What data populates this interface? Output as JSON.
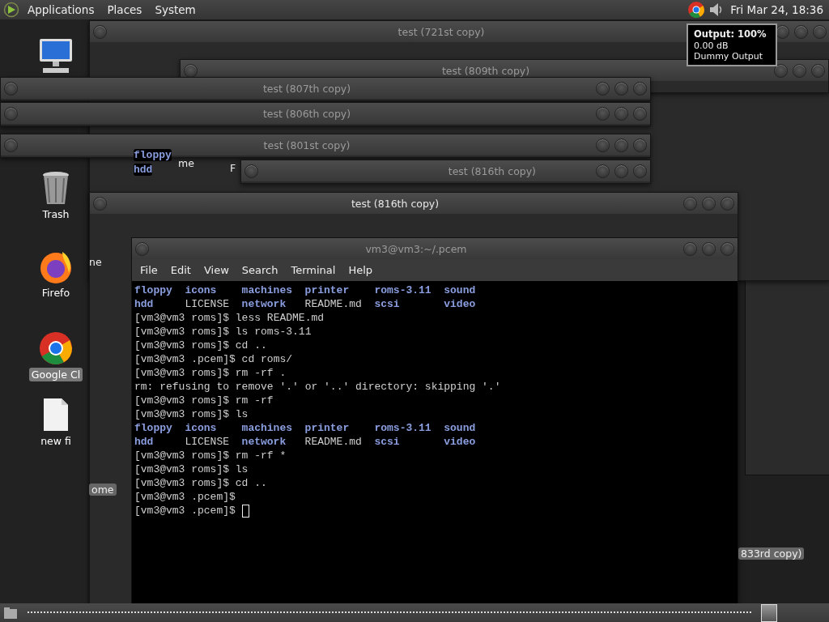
{
  "top_panel": {
    "menus": [
      "Applications",
      "Places",
      "System"
    ],
    "clock": "Fri Mar 24, 18:36"
  },
  "tooltip": {
    "title": "Output: 100%",
    "lines": [
      "0.00 dB",
      "Dummy Output"
    ]
  },
  "desktop_icons": [
    {
      "kind": "computer"
    },
    {
      "kind": "trash",
      "label": "Trash",
      "selected": false
    },
    {
      "kind": "firefox",
      "label": "Firefo",
      "selected": false
    },
    {
      "kind": "chrome",
      "label": "Google Cl",
      "selected": true
    },
    {
      "kind": "file",
      "label": "new fi",
      "selected": false
    }
  ],
  "windows": [
    {
      "title": "test (721st copy)"
    },
    {
      "title": "test (809th copy)"
    },
    {
      "title": "test (807th copy)"
    },
    {
      "title": "test (806th copy)"
    },
    {
      "title": "test (801st copy)"
    },
    {
      "title": "test (816th copy)"
    },
    {
      "title": "test (816th copy)"
    }
  ],
  "fragments": [
    {
      "kind": "dir",
      "text": "floppy"
    },
    {
      "kind": "dir",
      "text": "hdd"
    },
    {
      "kind": "label",
      "text": "me"
    },
    {
      "kind": "label",
      "text": "F"
    },
    {
      "kind": "label",
      "text": "ne"
    },
    {
      "kind": "chip",
      "text": "ome"
    },
    {
      "kind": "chip",
      "text": "833rd copy)"
    }
  ],
  "terminal": {
    "title": "vm3@vm3:~/.pcem",
    "menus": [
      "File",
      "Edit",
      "View",
      "Search",
      "Terminal",
      "Help"
    ],
    "lines": [
      {
        "kind": "ls",
        "items": [
          {
            "name": "floppy",
            "kind": "dir"
          },
          {
            "name": "icons",
            "kind": "dir"
          },
          {
            "name": "machines",
            "kind": "dir"
          },
          {
            "name": "printer",
            "kind": "dir"
          },
          {
            "name": "roms-3.11",
            "kind": "dir"
          },
          {
            "name": "sound",
            "kind": "dir"
          }
        ]
      },
      {
        "kind": "ls",
        "items": [
          {
            "name": "hdd",
            "kind": "dir"
          },
          {
            "name": "LICENSE",
            "kind": "file"
          },
          {
            "name": "network",
            "kind": "dir"
          },
          {
            "name": "README.md",
            "kind": "file"
          },
          {
            "name": "scsi",
            "kind": "dir"
          },
          {
            "name": "video",
            "kind": "dir"
          }
        ]
      },
      {
        "kind": "text",
        "text": "[vm3@vm3 roms]$ less README.md"
      },
      {
        "kind": "text",
        "text": "[vm3@vm3 roms]$ ls roms-3.11"
      },
      {
        "kind": "text",
        "text": "[vm3@vm3 roms]$ cd .."
      },
      {
        "kind": "text",
        "text": "[vm3@vm3 .pcem]$ cd roms/"
      },
      {
        "kind": "text",
        "text": "[vm3@vm3 roms]$ rm -rf ."
      },
      {
        "kind": "text",
        "text": "rm: refusing to remove '.' or '..' directory: skipping '.'"
      },
      {
        "kind": "text",
        "text": "[vm3@vm3 roms]$ rm -rf"
      },
      {
        "kind": "text",
        "text": "[vm3@vm3 roms]$ ls"
      },
      {
        "kind": "ls",
        "items": [
          {
            "name": "floppy",
            "kind": "dir"
          },
          {
            "name": "icons",
            "kind": "dir"
          },
          {
            "name": "machines",
            "kind": "dir"
          },
          {
            "name": "printer",
            "kind": "dir"
          },
          {
            "name": "roms-3.11",
            "kind": "dir"
          },
          {
            "name": "sound",
            "kind": "dir"
          }
        ]
      },
      {
        "kind": "ls",
        "items": [
          {
            "name": "hdd",
            "kind": "dir"
          },
          {
            "name": "LICENSE",
            "kind": "file"
          },
          {
            "name": "network",
            "kind": "dir"
          },
          {
            "name": "README.md",
            "kind": "file"
          },
          {
            "name": "scsi",
            "kind": "dir"
          },
          {
            "name": "video",
            "kind": "dir"
          }
        ]
      },
      {
        "kind": "text",
        "text": "[vm3@vm3 roms]$ rm -rf *"
      },
      {
        "kind": "text",
        "text": "[vm3@vm3 roms]$ ls"
      },
      {
        "kind": "text",
        "text": "[vm3@vm3 roms]$ cd .."
      },
      {
        "kind": "text",
        "text": "[vm3@vm3 .pcem]$"
      },
      {
        "kind": "text",
        "text": "[vm3@vm3 .pcem]$",
        "cursor": true
      }
    ]
  }
}
